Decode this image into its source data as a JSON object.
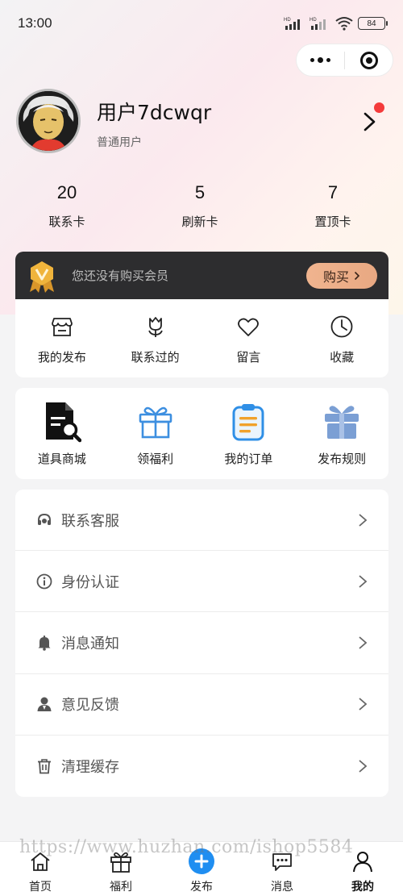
{
  "status_bar": {
    "time": "13:00",
    "battery": "84",
    "signal_labels": [
      "HD",
      "HD"
    ]
  },
  "capsule": {
    "more_icon": "more-dots-icon",
    "close_icon": "target-close-icon"
  },
  "profile": {
    "name": "用户7dcwqr",
    "level": "普通用户"
  },
  "stats": [
    {
      "value": "20",
      "label": "联系卡"
    },
    {
      "value": "5",
      "label": "刷新卡"
    },
    {
      "value": "7",
      "label": "置顶卡"
    }
  ],
  "vip": {
    "text": "您还没有购买会员",
    "button": "购买"
  },
  "quick_actions": [
    {
      "label": "我的发布",
      "icon": "shop-icon"
    },
    {
      "label": "联系过的",
      "icon": "tulip-icon"
    },
    {
      "label": "留言",
      "icon": "heart-icon"
    },
    {
      "label": "收藏",
      "icon": "clock-icon"
    }
  ],
  "services": [
    {
      "label": "道具商城",
      "icon": "document-search-icon"
    },
    {
      "label": "领福利",
      "icon": "gift-outline-icon"
    },
    {
      "label": "我的订单",
      "icon": "clipboard-icon"
    },
    {
      "label": "发布规则",
      "icon": "gift-solid-icon"
    }
  ],
  "menu": [
    {
      "label": "联系客服",
      "icon": "headset-icon"
    },
    {
      "label": "身份认证",
      "icon": "info-icon"
    },
    {
      "label": "消息通知",
      "icon": "bell-icon"
    },
    {
      "label": "意见反馈",
      "icon": "user-icon"
    },
    {
      "label": "清理缓存",
      "icon": "trash-icon"
    }
  ],
  "watermark": "https://www.huzhan.com/ishop5584",
  "tabbar": [
    {
      "label": "首页",
      "icon": "home-icon"
    },
    {
      "label": "福利",
      "icon": "gift-icon"
    },
    {
      "label": "发布",
      "icon": "plus-circle-icon"
    },
    {
      "label": "消息",
      "icon": "message-icon"
    },
    {
      "label": "我的",
      "icon": "profile-icon",
      "active": true
    }
  ],
  "colors": {
    "accent_blue": "#1f8ef1",
    "vip_bg": "#2d2d2f",
    "buy_btn": "#eeb08c",
    "red_dot": "#f43b3b"
  }
}
